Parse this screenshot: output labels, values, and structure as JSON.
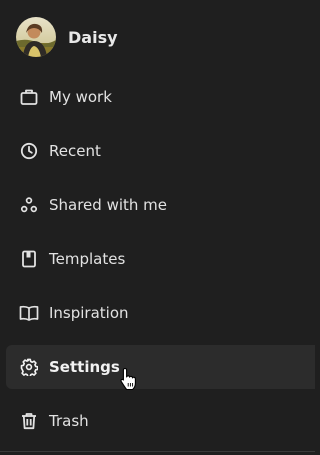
{
  "profile": {
    "name": "Daisy",
    "avatar_icon": "user-photo"
  },
  "nav": {
    "items": [
      {
        "label": "My work",
        "icon": "briefcase-icon"
      },
      {
        "label": "Recent",
        "icon": "clock-icon"
      },
      {
        "label": "Shared with me",
        "icon": "shared-nodes-icon"
      },
      {
        "label": "Templates",
        "icon": "template-icon"
      },
      {
        "label": "Inspiration",
        "icon": "book-icon"
      },
      {
        "label": "Settings",
        "icon": "gear-icon",
        "active": true
      },
      {
        "label": "Trash",
        "icon": "trash-icon"
      }
    ]
  },
  "colors": {
    "background": "#1f1f1f",
    "active_item": "#2c2c2c",
    "text": "#e2e2e2"
  }
}
